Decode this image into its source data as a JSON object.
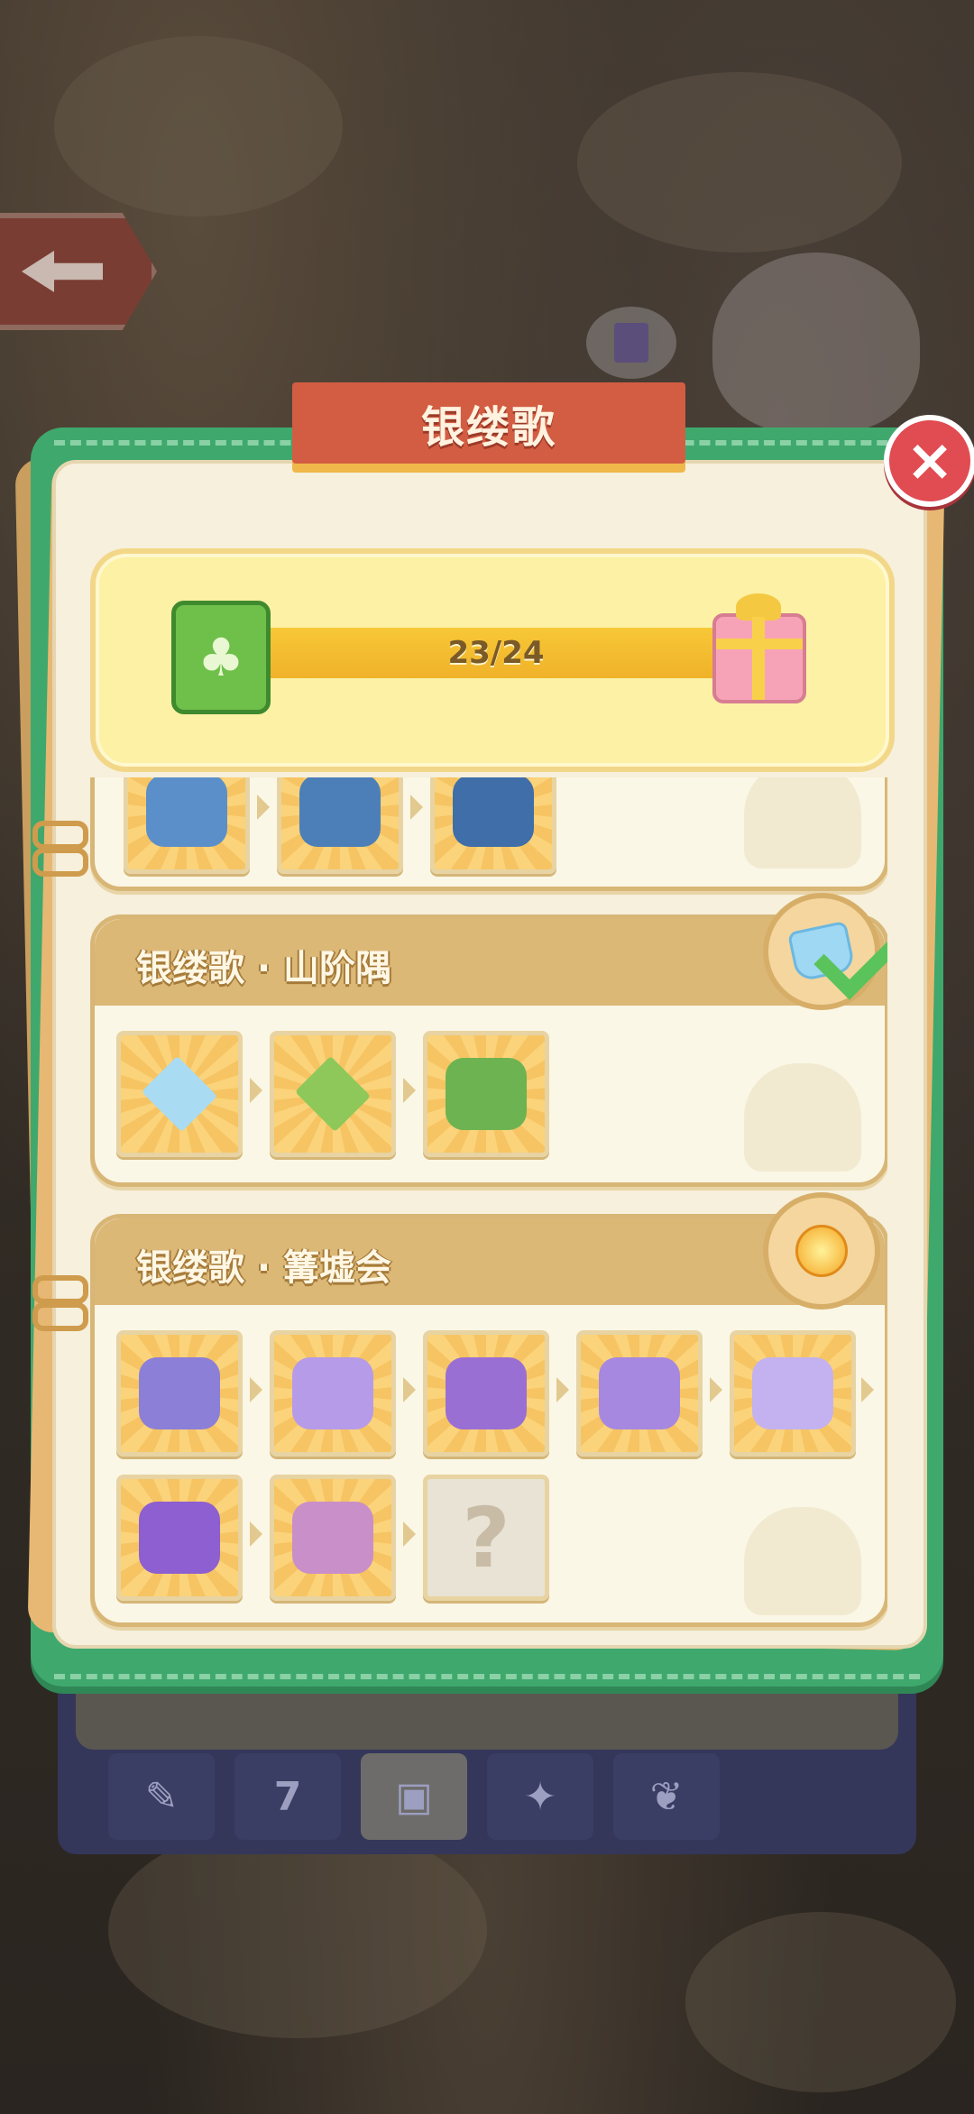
{
  "modal": {
    "title": "银缕歌",
    "close_icon": "×"
  },
  "progress": {
    "current": 23,
    "total": 24,
    "label": "23/24"
  },
  "sets": [
    {
      "title": "",
      "completed": true,
      "items": [
        "blue-garden-house",
        "blue-pavilion",
        "blue-castle"
      ]
    },
    {
      "title": "银缕歌 · 山阶隅",
      "completed": true,
      "reward_icon": "diamond-gem-icon",
      "items": [
        "ice-floor-tile",
        "grass-tile",
        "bamboo-grass-tile"
      ]
    },
    {
      "title": "银缕歌 · 篝墟会",
      "completed": false,
      "reward_icon": "sun-gem-icon",
      "items": [
        "silk-basket",
        "moon-harp",
        "purple-drum",
        "purple-fan",
        "moon-scroll",
        "purple-duck-dancers",
        "bouquet-ducks",
        "locked-item"
      ],
      "locked_label": "?"
    }
  ],
  "tab_bar": {
    "tabs": [
      "tools-icon",
      "calendar-icon",
      "cards-icon",
      "gift-icon",
      "leaf-icon"
    ],
    "calendar_label": "7",
    "active_index": 2
  }
}
